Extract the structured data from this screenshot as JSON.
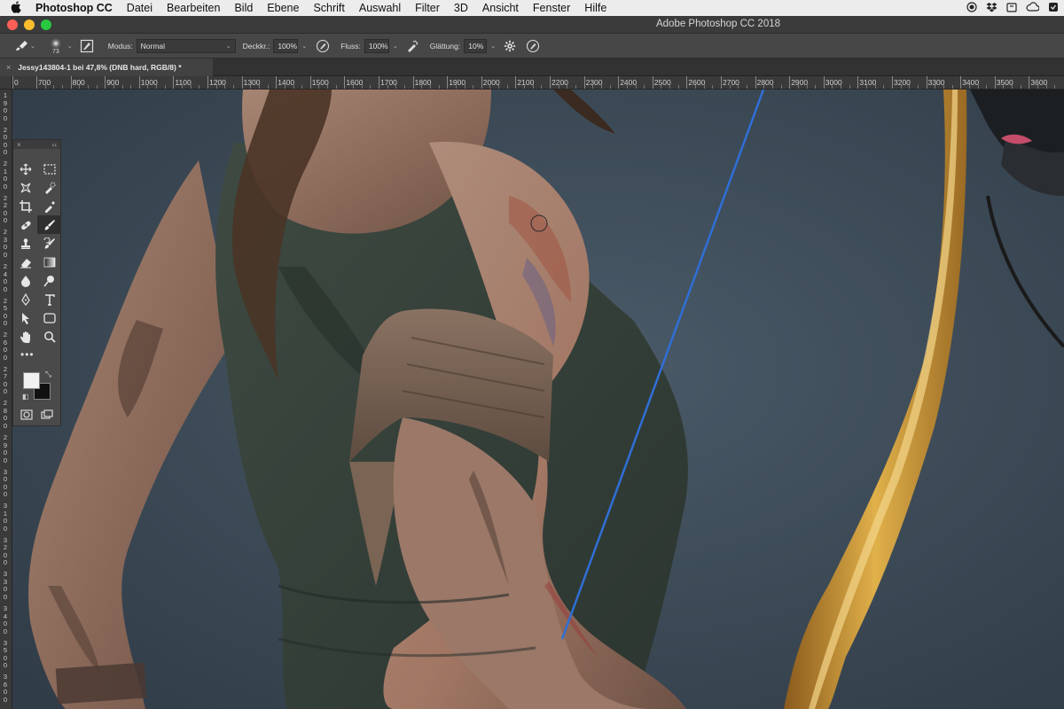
{
  "menubar": {
    "apple": "",
    "app_name": "Photoshop CC",
    "items": [
      "Datei",
      "Bearbeiten",
      "Bild",
      "Ebene",
      "Schrift",
      "Auswahl",
      "Filter",
      "3D",
      "Ansicht",
      "Fenster",
      "Hilfe"
    ]
  },
  "window": {
    "title": "Adobe Photoshop CC 2018"
  },
  "options": {
    "brush_size": "73",
    "modus_label": "Modus:",
    "modus_value": "Normal",
    "deckkraft_label": "Deckkr.:",
    "deckkraft_value": "100%",
    "fluss_label": "Fluss:",
    "fluss_value": "100%",
    "glaettung_label": "Glättung:",
    "glaettung_value": "10%"
  },
  "document": {
    "tab_title": "Jessy143804-1 bei 47,8% (DNB hard, RGB/8) *",
    "close_glyph": "×"
  },
  "ruler_top": [
    "0",
    "700",
    "800",
    "900",
    "1000",
    "1100",
    "1200",
    "1300",
    "1400",
    "1500",
    "1600",
    "1700",
    "1800",
    "1900",
    "2000",
    "2100",
    "2200",
    "2300",
    "2400",
    "2500",
    "2600",
    "2700",
    "2800",
    "2900",
    "3000",
    "3100",
    "3200",
    "3300",
    "3400",
    "3500",
    "3600"
  ],
  "ruler_left": [
    "1900",
    "2000",
    "2100",
    "2200",
    "2300",
    "2400",
    "2500",
    "2600",
    "2700",
    "2800",
    "2900",
    "3000",
    "3100",
    "3200",
    "3300",
    "3400",
    "3500",
    "3600"
  ],
  "tools": {
    "header_close": "×",
    "header_collapse": "‹‹",
    "more": "•••",
    "swap": "⤡",
    "reset": "◧"
  },
  "colors": {
    "foreground": "#f2f2f2",
    "background": "#111111",
    "canvas_backdrop": "#3d4c59",
    "bowstring": "#2f6fd6"
  }
}
